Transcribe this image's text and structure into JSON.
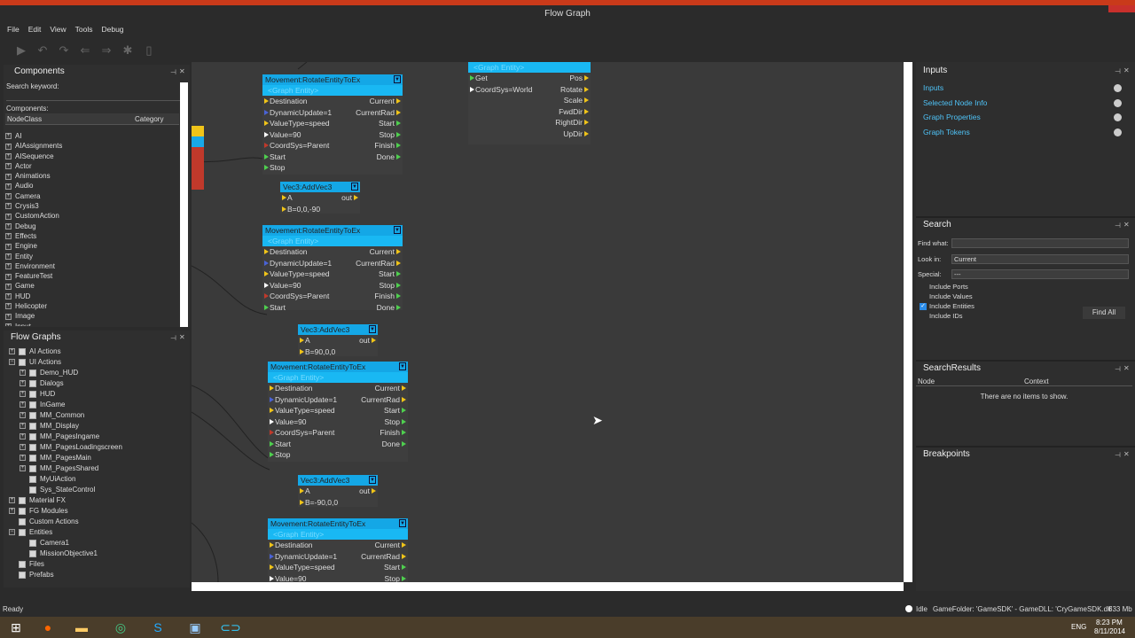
{
  "window": {
    "title": "Flow Graph"
  },
  "menu": [
    "File",
    "Edit",
    "View",
    "Tools",
    "Debug"
  ],
  "components": {
    "title": "Components",
    "search_label": "Search keyword:",
    "components_label": "Components:",
    "col_nodeclass": "NodeClass",
    "col_category": "Category",
    "items": [
      "AI",
      "AIAssignments",
      "AISequence",
      "Actor",
      "Animations",
      "Audio",
      "Camera",
      "Crysis3",
      "CustomAction",
      "Debug",
      "Effects",
      "Engine",
      "Entity",
      "Environment",
      "FeatureTest",
      "Game",
      "HUD",
      "Helicopter",
      "Image",
      "Input"
    ]
  },
  "flowgraphs": {
    "title": "Flow Graphs",
    "items": [
      {
        "label": "AI Actions",
        "level": 0,
        "type": "plus"
      },
      {
        "label": "UI Actions",
        "level": 0,
        "type": "minus"
      },
      {
        "label": "Demo_HUD",
        "level": 1,
        "type": "plus"
      },
      {
        "label": "Dialogs",
        "level": 1,
        "type": "plus"
      },
      {
        "label": "HUD",
        "level": 1,
        "type": "plus"
      },
      {
        "label": "InGame",
        "level": 1,
        "type": "plus"
      },
      {
        "label": "MM_Common",
        "level": 1,
        "type": "plus"
      },
      {
        "label": "MM_Display",
        "level": 1,
        "type": "plus"
      },
      {
        "label": "MM_PagesIngame",
        "level": 1,
        "type": "plus"
      },
      {
        "label": "MM_PagesLoadingscreen",
        "level": 1,
        "type": "plus"
      },
      {
        "label": "MM_PagesMain",
        "level": 1,
        "type": "plus"
      },
      {
        "label": "MM_PagesShared",
        "level": 1,
        "type": "plus"
      },
      {
        "label": "MyUiAction",
        "level": 1,
        "type": "file"
      },
      {
        "label": "Sys_StateControl",
        "level": 1,
        "type": "file"
      },
      {
        "label": "Material FX",
        "level": 0,
        "type": "plus"
      },
      {
        "label": "FG Modules",
        "level": 0,
        "type": "plus"
      },
      {
        "label": "Custom Actions",
        "level": 0,
        "type": "none"
      },
      {
        "label": "Entities",
        "level": 0,
        "type": "minus"
      },
      {
        "label": "Camera1",
        "level": 1,
        "type": "file"
      },
      {
        "label": "MissionObjective1",
        "level": 1,
        "type": "file"
      },
      {
        "label": "Files",
        "level": 0,
        "type": "none"
      },
      {
        "label": "Prefabs",
        "level": 0,
        "type": "none"
      }
    ]
  },
  "nodes": {
    "rotate_title": "Movement:RotateEntityToEx",
    "graph_entity": "<Graph Entity>",
    "rotate_inputs": [
      "Destination",
      "DynamicUpdate=1",
      "ValueType=speed",
      "Value=90",
      "CoordSys=Parent",
      "Start",
      "Stop"
    ],
    "rotate_outputs": [
      "Current",
      "CurrentRad",
      "Start",
      "Stop",
      "Finish",
      "Done"
    ],
    "vec_title": "Vec3:AddVec3",
    "vec_a": "A",
    "vec_out": "out",
    "vec_b1": "B=0,0,-90",
    "vec_b2": "B=90,0,0",
    "vec_b3": "B=-90,0,0",
    "entity_inputs": [
      "Get",
      "CoordSys=World"
    ],
    "entity_outputs": [
      "Pos",
      "Rotate",
      "Scale",
      "FwdDir",
      "RightDir",
      "UpDir"
    ]
  },
  "inputs": {
    "title": "Inputs",
    "links": [
      "Inputs",
      "Selected Node Info",
      "Graph Properties",
      "Graph Tokens"
    ]
  },
  "search": {
    "title": "Search",
    "find_what": "Find what:",
    "look_in": "Look in:",
    "look_in_value": "Current",
    "special": "Special:",
    "special_value": "---",
    "options": [
      {
        "label": "Include Ports",
        "checked": false
      },
      {
        "label": "Include Values",
        "checked": false
      },
      {
        "label": "Include Entities",
        "checked": true
      },
      {
        "label": "Include IDs",
        "checked": false
      }
    ],
    "find_all": "Find All"
  },
  "results": {
    "title": "SearchResults",
    "col_node": "Node",
    "col_context": "Context",
    "empty": "There are no items to show."
  },
  "breakpoints": {
    "title": "Breakpoints"
  },
  "status": {
    "left": "Ready",
    "idle": "Idle",
    "game_folder": "GameFolder: 'GameSDK' - GameDLL: 'CryGameSDK.dll'",
    "memory": "633 Mb"
  },
  "clock": {
    "time": "8:23 PM",
    "date": "8/11/2014",
    "lang": "ENG"
  }
}
